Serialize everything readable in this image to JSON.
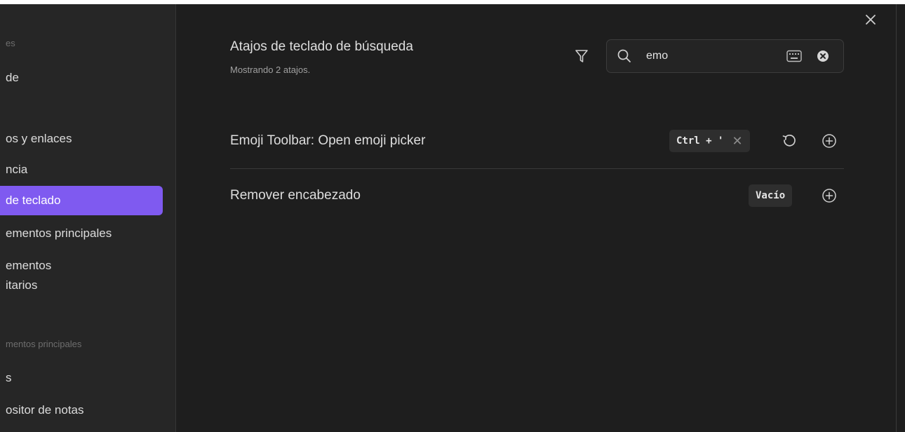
{
  "sidebar": {
    "groups": [
      {
        "label": "es"
      },
      {
        "label": "mentos principales"
      }
    ],
    "items": [
      {
        "label": "de"
      },
      {
        "label": "os y enlaces"
      },
      {
        "label": "ncia"
      },
      {
        "label": "de teclado"
      },
      {
        "label": "ementos principales"
      },
      {
        "label": "ementos"
      },
      {
        "label": "itarios"
      },
      {
        "label": "s"
      },
      {
        "label": "ositor de notas"
      }
    ]
  },
  "header": {
    "title": "Atajos de teclado de búsqueda",
    "subtitle": "Mostrando 2 atajos."
  },
  "search": {
    "value": "emo",
    "placeholder": ""
  },
  "hotkeys": [
    {
      "command": "Emoji Toolbar: Open emoji picker",
      "keys": "Ctrl + '"
    },
    {
      "command": "Remover encabezado",
      "keys": "Vacío"
    }
  ],
  "icons": {
    "close": "close-icon",
    "filter": "filter-icon",
    "search": "search-icon",
    "keyboard": "keyboard-icon",
    "clear": "clear-icon",
    "reset": "reset-icon",
    "add": "add-icon"
  },
  "colors": {
    "accent": "#7f5af0",
    "background": "#1e1e1e",
    "sidebar": "#262626"
  }
}
